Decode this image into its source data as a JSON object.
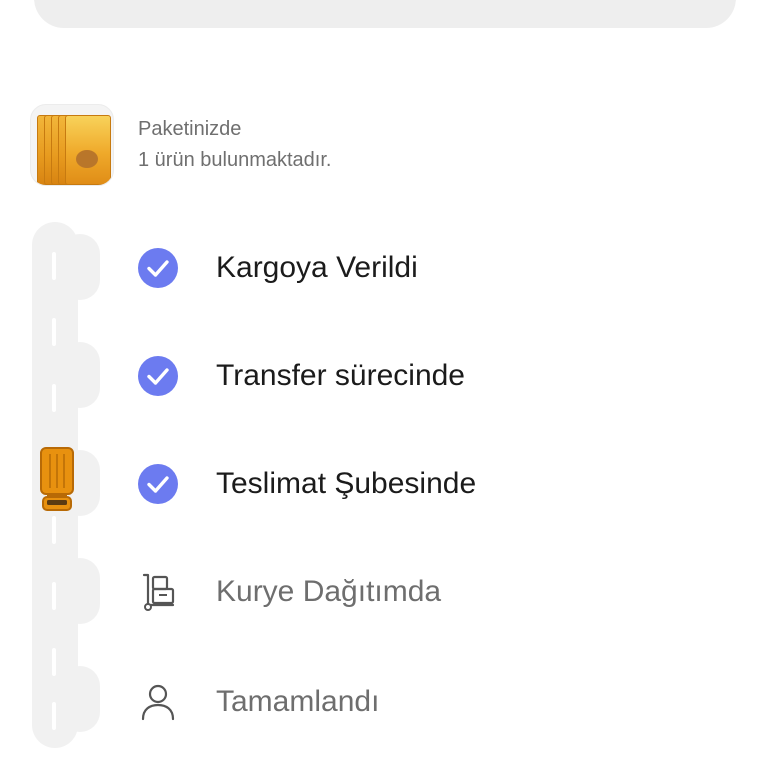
{
  "package": {
    "title": "Paketinizde",
    "count_text": "1 ürün bulunmaktadır."
  },
  "steps": [
    {
      "label": "Kargoya Verildi",
      "status": "done",
      "icon": "check-icon"
    },
    {
      "label": "Transfer sürecinde",
      "status": "done",
      "icon": "check-icon"
    },
    {
      "label": "Teslimat Şubesinde",
      "status": "done",
      "icon": "check-icon"
    },
    {
      "label": "Kurye Dağıtımda",
      "status": "pending",
      "icon": "courier-hand-truck-icon"
    },
    {
      "label": "Tamamlandı",
      "status": "pending",
      "icon": "person-icon"
    }
  ],
  "colors": {
    "check": "#6c7bf0",
    "truck": "#e8910f",
    "track": "#f1f1f1"
  }
}
